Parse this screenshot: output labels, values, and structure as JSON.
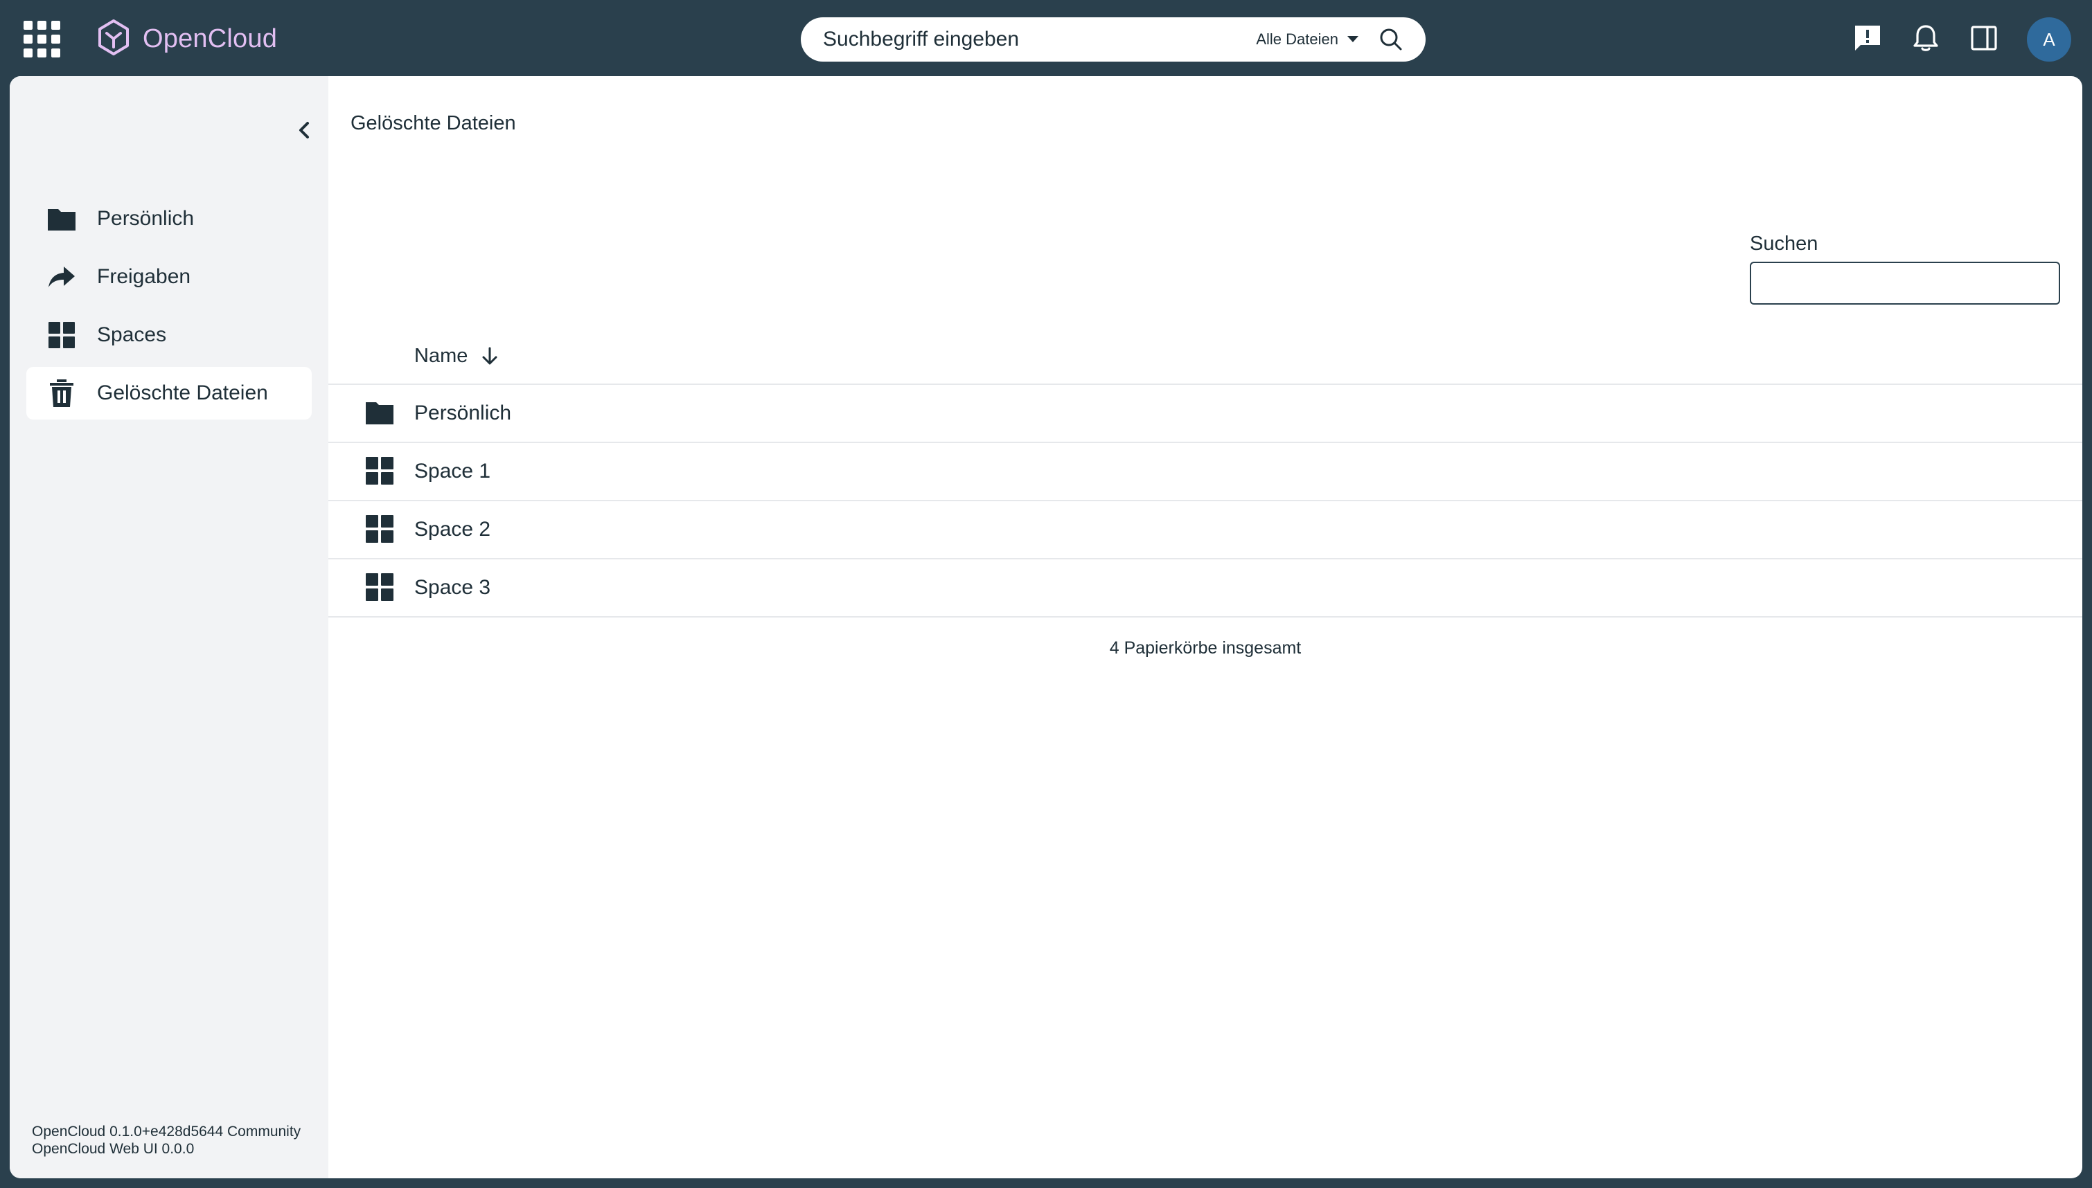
{
  "topbar": {
    "brand": "OpenCloud",
    "search": {
      "placeholder": "Suchbegriff eingeben",
      "scope": "Alle Dateien"
    },
    "icons": [
      "apps-grid-icon",
      "feedback-icon",
      "bell-icon",
      "sidebar-toggle-icon"
    ],
    "avatar_initial": "A",
    "colors": {
      "bar": "#2a404d",
      "brand": "#e2bff2",
      "avatar": "#2f6a9c"
    }
  },
  "sidebar": {
    "items": [
      {
        "label": "Persönlich",
        "icon": "folder-icon"
      },
      {
        "label": "Freigaben",
        "icon": "share-icon"
      },
      {
        "label": "Spaces",
        "icon": "spaces-grid-icon"
      },
      {
        "label": "Gelöschte Dateien",
        "icon": "trash-icon",
        "active": true
      }
    ],
    "version": [
      "OpenCloud 0.1.0+e428d5644 Community",
      "OpenCloud Web UI 0.0.0"
    ]
  },
  "main": {
    "breadcrumb": "Gelöschte Dateien",
    "filter": {
      "label": "Suchen",
      "value": ""
    },
    "table": {
      "columns": [
        "Name"
      ],
      "sort": "descending",
      "rows": [
        {
          "name": "Persönlich",
          "icon": "folder-icon"
        },
        {
          "name": "Space 1",
          "icon": "spaces-grid-icon"
        },
        {
          "name": "Space 2",
          "icon": "spaces-grid-icon"
        },
        {
          "name": "Space 3",
          "icon": "spaces-grid-icon"
        }
      ]
    },
    "footer": "4 Papierkörbe insgesamt"
  }
}
